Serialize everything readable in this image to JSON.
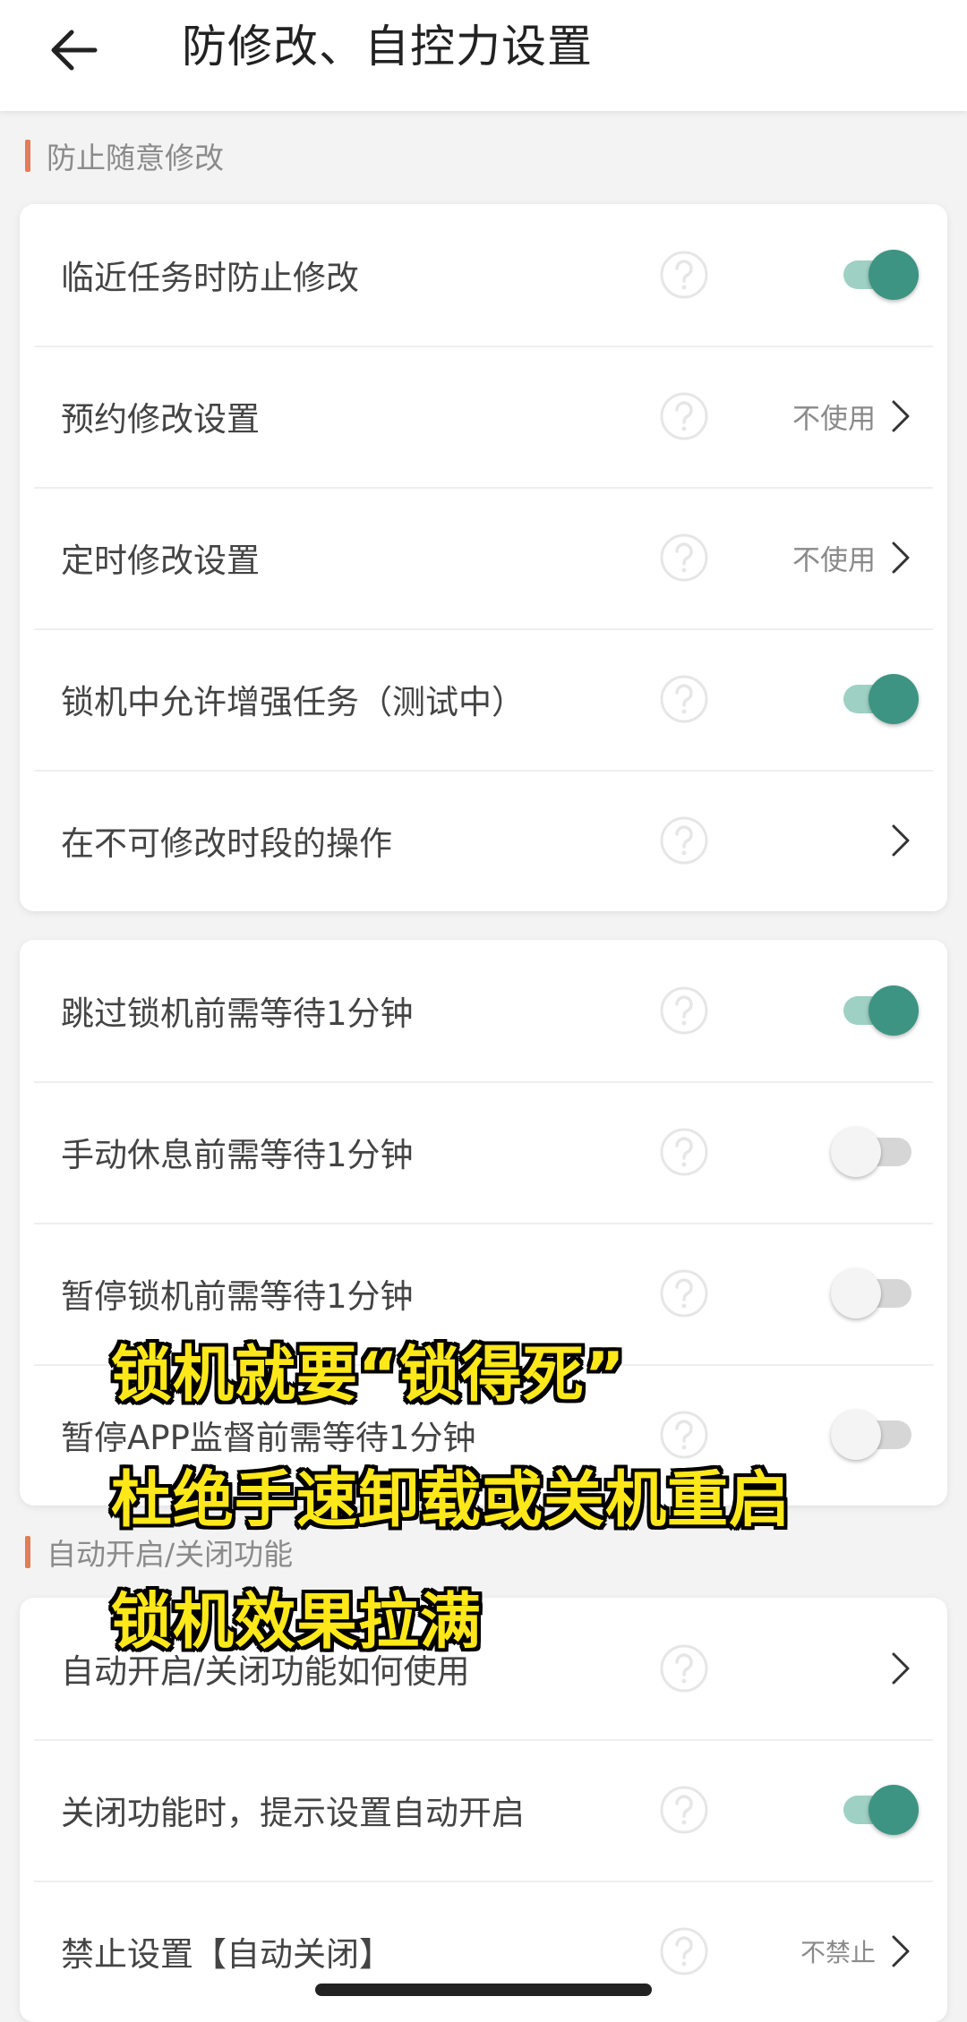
{
  "header": {
    "title": "防修改、自控力设置"
  },
  "sections": [
    {
      "label": "防止随意修改",
      "cards": [
        {
          "rows": [
            {
              "label": "临近任务时防止修改",
              "type": "toggle",
              "on": true
            },
            {
              "label": "预约修改设置",
              "type": "link",
              "value": "不使用"
            },
            {
              "label": "定时修改设置",
              "type": "link",
              "value": "不使用"
            },
            {
              "label": "锁机中允许增强任务（测试中）",
              "type": "toggle",
              "on": true
            },
            {
              "label": "在不可修改时段的操作",
              "type": "link",
              "value": ""
            }
          ]
        },
        {
          "rows": [
            {
              "label": "跳过锁机前需等待1分钟",
              "type": "toggle",
              "on": true
            },
            {
              "label": "手动休息前需等待1分钟",
              "type": "toggle",
              "on": false
            },
            {
              "label": "暂停锁机前需等待1分钟",
              "type": "toggle",
              "on": false
            },
            {
              "label": "暂停APP监督前需等待1分钟",
              "type": "toggle",
              "on": false
            }
          ]
        }
      ]
    },
    {
      "label": "自动开启/关闭功能",
      "cards": [
        {
          "rows": [
            {
              "label": "自动开启/关闭功能如何使用",
              "type": "link",
              "value": ""
            },
            {
              "label": "关闭功能时，提示设置自动开启",
              "type": "toggle",
              "on": true
            },
            {
              "label": "禁止设置【自动关闭】",
              "type": "link",
              "value": "不禁止"
            }
          ]
        }
      ]
    }
  ],
  "overlay_captions": [
    "锁机就要“锁得死”",
    "杜绝手速卸载或关机重启",
    "锁机效果拉满"
  ],
  "colors": {
    "accent": "#3d9483",
    "accent_track": "#9fd0c4",
    "section_marker": "#e37c58",
    "caption": "#ffe81a"
  },
  "icons": {
    "back": "arrow-left-icon",
    "help": "help-circle-icon",
    "chevron": "chevron-right-icon"
  }
}
